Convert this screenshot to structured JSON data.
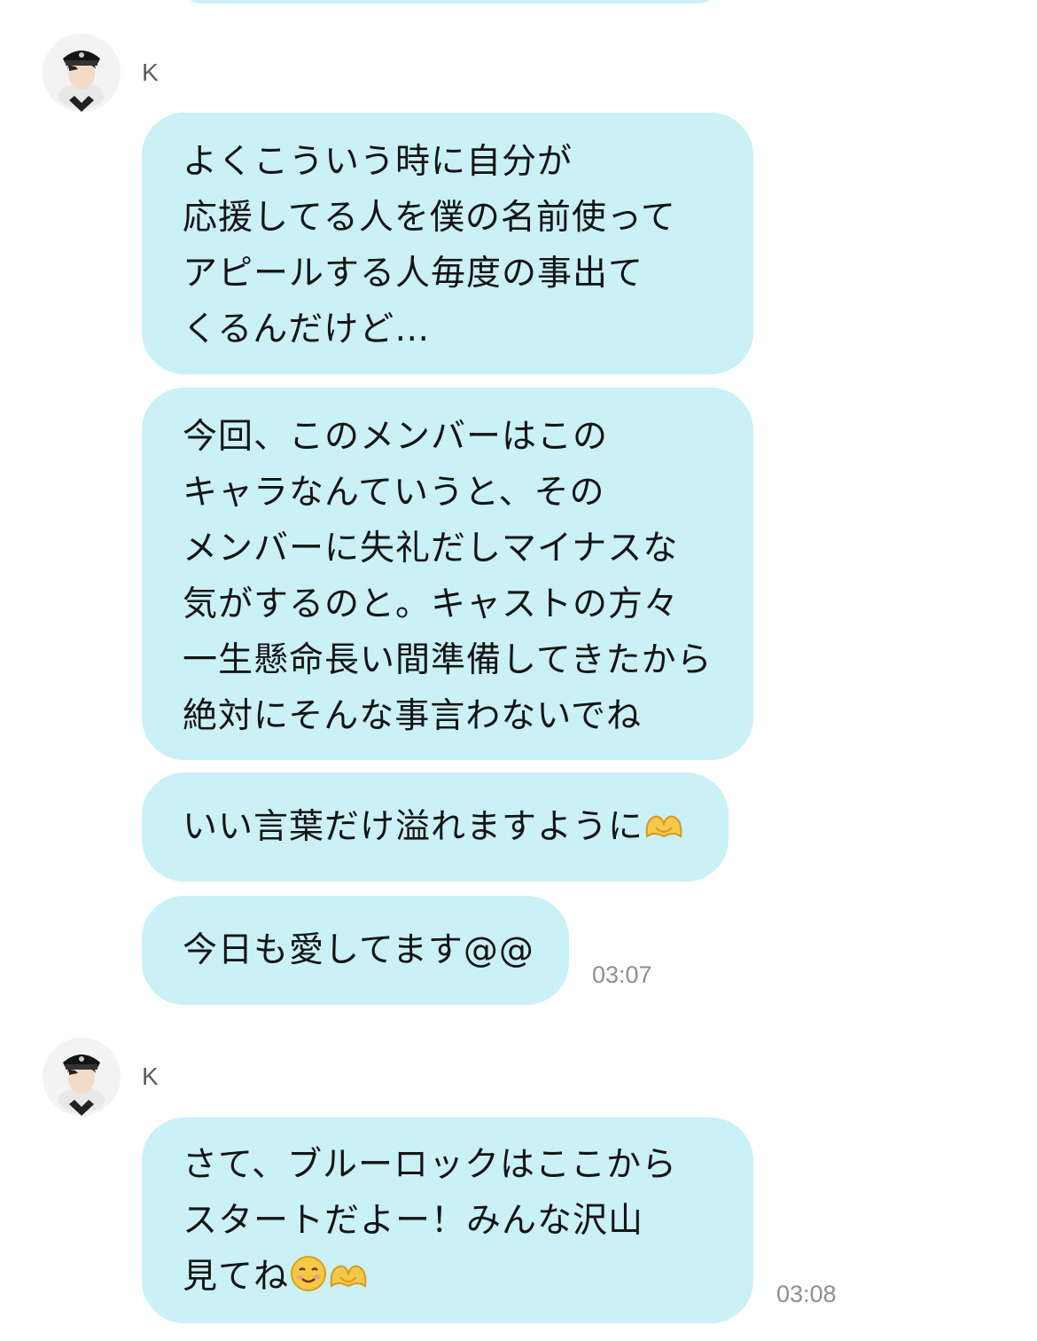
{
  "colors": {
    "bubble": "#c9f1f6",
    "text": "#141414",
    "timestamp": "#8f8f8f",
    "sender": "#5c5c5c",
    "background": "#ffffff"
  },
  "messages_group_1": {
    "sender": "K",
    "avatar_icon": "profile-photo-avatar",
    "bubbles": [
      {
        "lines": [
          "よくこういう時に自分が",
          "応援してる人を僕の名前使って",
          "アピールする人毎度の事出て",
          "くるんだけど…"
        ]
      },
      {
        "lines": [
          "今回、このメンバーはこの",
          "キャラなんていうと、その",
          "メンバーに失礼だしマイナスな",
          "気がするのと。キャストの方々",
          "一生懸命長い間準備してきたから",
          "絶対にそんな事言わないでね"
        ]
      },
      {
        "lines": [
          "いい言葉だけ溢れますように"
        ],
        "emoji": "heart-hands-emoji"
      },
      {
        "lines": [
          "今日も愛してます@@"
        ]
      }
    ],
    "timestamp": "03:07"
  },
  "messages_group_2": {
    "sender": "K",
    "avatar_icon": "profile-photo-avatar",
    "bubbles": [
      {
        "lines": [
          "さて、ブルーロックはここから",
          "スタートだよー！みんな沢山",
          "見てね"
        ],
        "emoji": [
          "smiling-face-emoji",
          "heart-hands-emoji"
        ]
      }
    ],
    "timestamp": "03:08"
  }
}
